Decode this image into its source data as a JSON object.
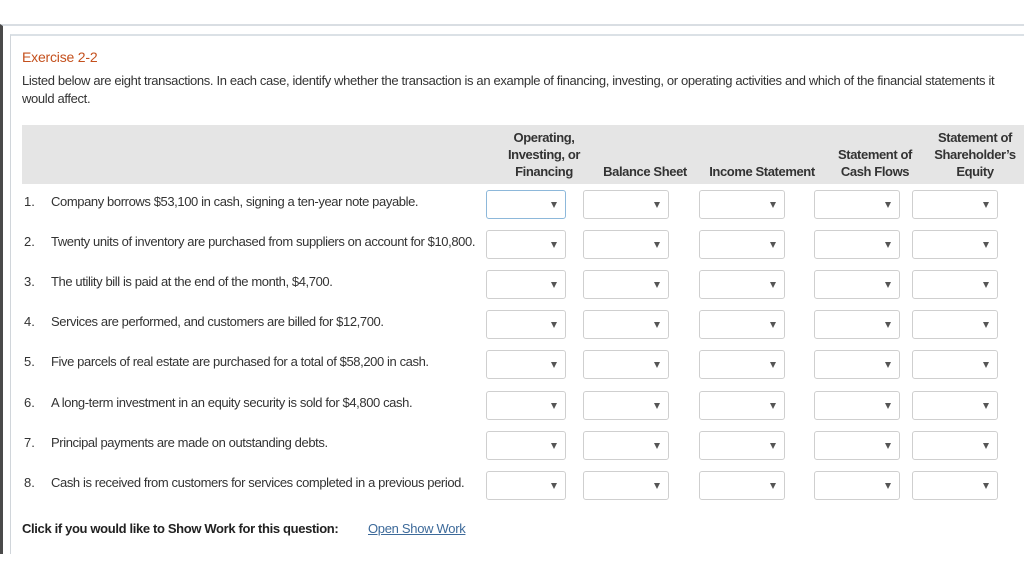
{
  "exercise": {
    "title": "Exercise 2-2",
    "instructions": "Listed below are eight transactions. In each case, identify whether the transaction is an example of financing, investing, or operating activities and which of the financial statements it would affect."
  },
  "table": {
    "columns": [
      {
        "key": "activity",
        "label": "Operating, Investing, or Financing"
      },
      {
        "key": "balance_sheet",
        "label": "Balance Sheet"
      },
      {
        "key": "income_statement",
        "label": "Income Statement"
      },
      {
        "key": "cash_flows",
        "label": "Statement of Cash Flows"
      },
      {
        "key": "shareholders_equity",
        "label": "Statement of Shareholder’s Equity"
      }
    ],
    "rows": [
      {
        "num": "1.",
        "text": "Company borrows $53,100 in cash, signing a ten-year note payable.",
        "values": [
          "",
          "",
          "",
          "",
          ""
        ]
      },
      {
        "num": "2.",
        "text": "Twenty units of inventory are purchased from suppliers on account for $10,800.",
        "values": [
          "",
          "",
          "",
          "",
          ""
        ]
      },
      {
        "num": "3.",
        "text": "The utility bill is paid at the end of the month, $4,700.",
        "values": [
          "",
          "",
          "",
          "",
          ""
        ]
      },
      {
        "num": "4.",
        "text": "Services are performed, and customers are billed for $12,700.",
        "values": [
          "",
          "",
          "",
          "",
          ""
        ]
      },
      {
        "num": "5.",
        "text": "Five parcels of real estate are purchased for a total of $58,200 in cash.",
        "values": [
          "",
          "",
          "",
          "",
          ""
        ]
      },
      {
        "num": "6.",
        "text": "A long-term investment in an equity security is sold for $4,800 cash.",
        "values": [
          "",
          "",
          "",
          "",
          ""
        ]
      },
      {
        "num": "7.",
        "text": "Principal payments are made on outstanding debts.",
        "values": [
          "",
          "",
          "",
          "",
          ""
        ]
      },
      {
        "num": "8.",
        "text": "Cash is received from customers for services completed in a previous period.",
        "values": [
          "",
          "",
          "",
          "",
          ""
        ]
      }
    ],
    "dropdown_icon": "triangle-down"
  },
  "footer": {
    "prompt": "Click if you would like to Show Work for this question:",
    "link": "Open Show Work"
  }
}
